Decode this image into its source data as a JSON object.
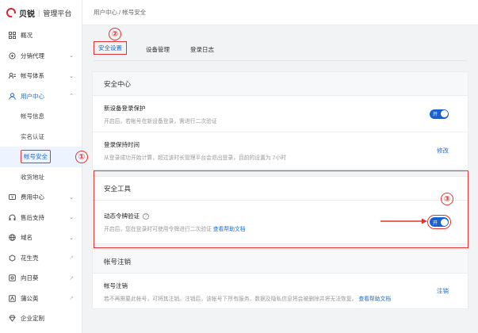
{
  "brand": {
    "name": "贝锐",
    "separator": "|",
    "subtitle": "管理平台"
  },
  "sidebar": {
    "items": [
      {
        "label": "概况",
        "icon": "grid-icon"
      },
      {
        "label": "分销代理",
        "icon": "share-icon",
        "chevron": "⌄"
      },
      {
        "label": "帐号体系",
        "icon": "account-tree-icon",
        "chevron": "⌄"
      },
      {
        "label": "用户中心",
        "icon": "user-icon",
        "chevron": "⌃"
      }
    ],
    "sub_items": [
      {
        "label": "帐号信息"
      },
      {
        "label": "实名认证"
      },
      {
        "label": "帐号安全"
      },
      {
        "label": "收货地址"
      }
    ],
    "items_after": [
      {
        "label": "费用中心",
        "icon": "wallet-icon",
        "chevron": "⌄"
      },
      {
        "label": "售后支持",
        "icon": "headset-icon",
        "chevron": "⌄"
      },
      {
        "label": "域名",
        "icon": "globe-icon",
        "chevron": "⌄"
      },
      {
        "label": "花生壳",
        "icon": "peanut-icon",
        "ext": "↗"
      },
      {
        "label": "向日葵",
        "icon": "sunflower-icon",
        "ext": "↗"
      },
      {
        "label": "蒲公英",
        "icon": "dandelion-icon",
        "ext": "↗"
      },
      {
        "label": "企业定制",
        "icon": "diamond-icon"
      }
    ]
  },
  "markers": {
    "m1": "①",
    "m2": "②",
    "m3": "③"
  },
  "breadcrumb": "用户中心 / 帐号安全",
  "tabs": [
    {
      "label": "安全设置"
    },
    {
      "label": "设备管理"
    },
    {
      "label": "登录日志"
    }
  ],
  "security_center": {
    "title": "安全中心",
    "rows": [
      {
        "title": "新设备登录保护",
        "desc": "开启后，若帐号在新设备登录，需进行二次验证",
        "toggle_label": "开"
      },
      {
        "title": "登录保持时间",
        "desc": "从登录成功开始计算，超过该时长管理平台会退出登录，目前的设置为 7小时",
        "action": "修改"
      }
    ]
  },
  "security_tools": {
    "title": "安全工具",
    "rows": [
      {
        "title": "动态令牌验证",
        "help_glyph": "?",
        "desc": "开启后，您在登录时可使用令牌进行二次验证",
        "help_link": "查看帮助文档",
        "toggle_label": "开"
      }
    ]
  },
  "account_cancel": {
    "title": "帐号注销",
    "rows": [
      {
        "title": "帐号注销",
        "desc": "若不再需要此帐号，可将其注销。注销后，该帐号下所有服务、数据及隐私信息将会被删除并将无法恢复。",
        "help_link": "查看帮助文档",
        "action": "注销"
      }
    ]
  },
  "colors": {
    "accent": "#1a6cd4",
    "annotation": "#e03434",
    "toggle_on": "#1a5fd0"
  }
}
